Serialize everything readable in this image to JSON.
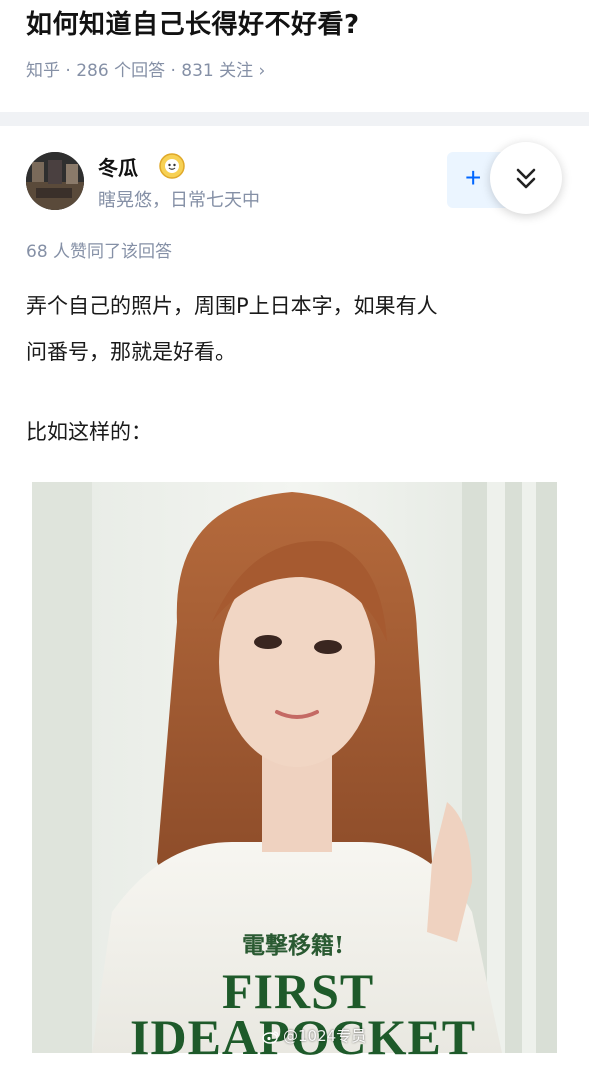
{
  "question": {
    "title": "如何知道自己长得好不好看?",
    "meta": "知乎 · 286 个回答 · 831 关注 ›"
  },
  "answer": {
    "author_name": "冬瓜",
    "author_bio": "瞎晃悠，日常七天中",
    "follow_label": "+",
    "upvote_info": "68 人赞同了该回答",
    "paragraph_1a": "弄个自己的照片，周围P上日本字，如果有人",
    "paragraph_1b": "问番号，那就是好看。",
    "paragraph_2": "比如这样的：",
    "image": {
      "line1": "電撃移籍!",
      "line2": "FIRST",
      "line3": "IDEAPOCKET"
    }
  },
  "watermark": "@1024专员",
  "colors": {
    "accent": "#0066ff",
    "meta_text": "#8590a6",
    "separator": "#f0f2f5",
    "cover_green": "#1e5a2a"
  },
  "icons": {
    "badge": "badge-icon",
    "collapse": "chevron-double-down-icon",
    "watermark": "weibo-icon"
  }
}
